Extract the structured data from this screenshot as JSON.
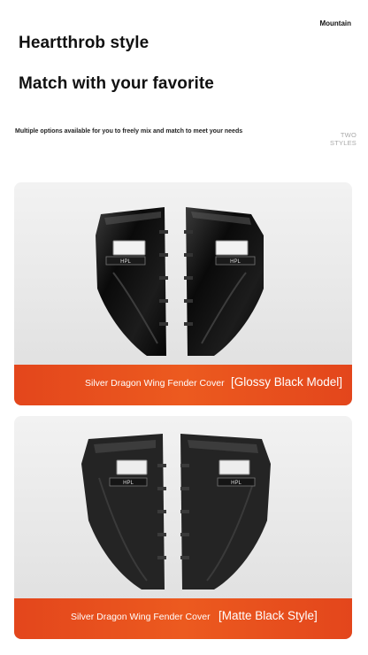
{
  "header": {
    "brand": "Mountain",
    "headline_1": "Heartthrob style",
    "headline_2": "Match with your favorite",
    "subline": "Multiple options available for you to freely mix and match to meet your needs",
    "two_styles_line1": "TWO",
    "two_styles_line2": "STYLES"
  },
  "products": [
    {
      "name": "Silver Dragon Wing Fender Cover",
      "model": "[Glossy Black Model]",
      "finish_color": "#0b0b0b",
      "badge_text": "HPL"
    },
    {
      "name": "Silver Dragon Wing Fender Cover",
      "model": "[Matte Black Style]",
      "finish_color": "#262626",
      "badge_text": "HPL"
    }
  ],
  "colors": {
    "accent": "#e84f1e",
    "card_bg": "#e9e9e9"
  }
}
